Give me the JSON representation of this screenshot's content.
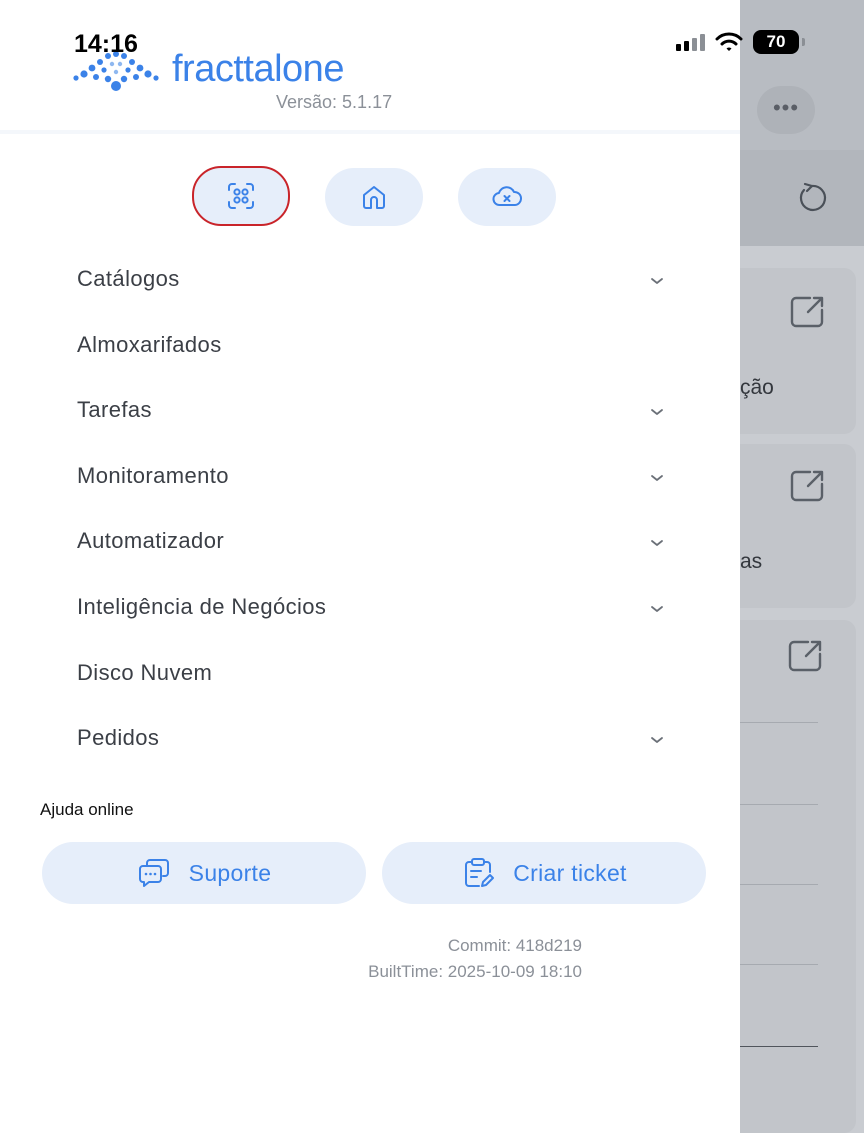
{
  "status_bar": {
    "time": "14:16",
    "battery": "70"
  },
  "app": {
    "brand_part1": "fracttal",
    "brand_part2": "one",
    "version": "Versão: 5.1.17"
  },
  "quick_actions": [
    {
      "icon": "scan-qr-icon"
    },
    {
      "icon": "home-icon"
    },
    {
      "icon": "cloud-offline-icon"
    }
  ],
  "menu": {
    "items": [
      {
        "label": "Catálogos",
        "expandable": true
      },
      {
        "label": "Almoxarifados",
        "expandable": false
      },
      {
        "label": "Tarefas",
        "expandable": true
      },
      {
        "label": "Monitoramento",
        "expandable": true
      },
      {
        "label": "Automatizador",
        "expandable": true
      },
      {
        "label": "Inteligência de Negócios",
        "expandable": true
      },
      {
        "label": "Disco Nuvem",
        "expandable": false
      },
      {
        "label": "Pedidos",
        "expandable": true
      }
    ]
  },
  "help": {
    "title": "Ajuda online",
    "support_label": "Suporte",
    "ticket_label": "Criar ticket"
  },
  "build": {
    "commit": "Commit: 418d219",
    "built_time": "BuiltTime: 2025-10-09 18:10"
  },
  "background": {
    "more_label": "•••",
    "card1_text": "ção",
    "card2_text": "as"
  },
  "colors": {
    "accent": "#3b82e8",
    "chip_bg": "#e6eefa",
    "highlight_ring": "#c9242a"
  }
}
